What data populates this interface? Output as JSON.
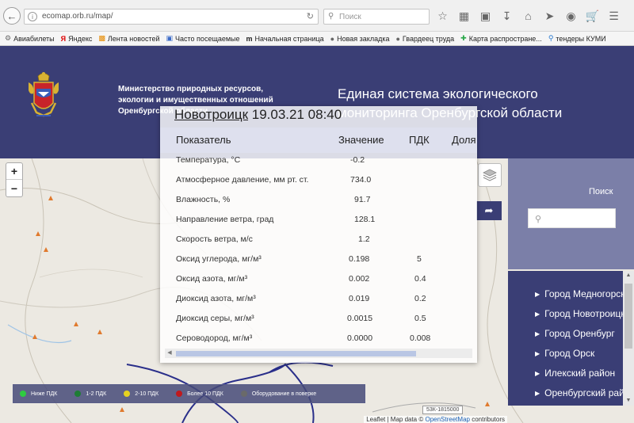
{
  "browser": {
    "url": "ecomap.orb.ru/map/",
    "search_placeholder": "Поиск",
    "toolbar_icons": [
      "star-icon",
      "clipboard-icon",
      "gift-icon",
      "download-icon",
      "home-icon",
      "send-icon",
      "eye-icon",
      "cart-icon",
      "menu-icon"
    ],
    "bookmarks": [
      {
        "label": "Авиабилеты",
        "icon": "gear-icon"
      },
      {
        "label": "Яндекс",
        "icon": "yandex-icon"
      },
      {
        "label": "Лента новостей",
        "icon": "feed-icon"
      },
      {
        "label": "Часто посещаемые",
        "icon": "star-icon"
      },
      {
        "label": "Начальная страница",
        "icon": "m-icon"
      },
      {
        "label": "Новая закладка",
        "icon": "globe-icon"
      },
      {
        "label": "Гвардеец труда",
        "icon": "globe-icon"
      },
      {
        "label": "Карта распростране...",
        "icon": "plus-icon"
      },
      {
        "label": "тендеры КУМИ",
        "icon": "pin-icon"
      }
    ]
  },
  "header": {
    "ministry_lines": [
      "Министерство природных ресурсов,",
      "экологии и имущественных отношений",
      "Оренбургской области"
    ],
    "title_lines": [
      "Единая система экологического",
      "мониторинга Оренбургской области"
    ]
  },
  "popup": {
    "city": "Новотроицк",
    "datetime": "19.03.21 08:40",
    "columns": [
      "Показатель",
      "Значение",
      "ПДК",
      "Доля ПДК"
    ],
    "rows": [
      {
        "name": "Температура, °С",
        "value": "-0.2",
        "pdk": ""
      },
      {
        "name": "Атмосферное давление, мм рт. ст.",
        "value": "734.0",
        "pdk": ""
      },
      {
        "name": "Влажность, %",
        "value": "91.7",
        "pdk": ""
      },
      {
        "name": "Направление ветра, град",
        "value": "128.1",
        "pdk": ""
      },
      {
        "name": "Скорость ветра, м/с",
        "value": "1.2",
        "pdk": ""
      },
      {
        "name": "Оксид углерода, мг/м³",
        "value": "0.198",
        "pdk": "5"
      },
      {
        "name": "Оксид азота, мг/м³",
        "value": "0.002",
        "pdk": "0.4"
      },
      {
        "name": "Диоксид азота, мг/м³",
        "value": "0.019",
        "pdk": "0.2"
      },
      {
        "name": "Диоксид серы, мг/м³",
        "value": "0.0015",
        "pdk": "0.5"
      },
      {
        "name": "Сероводород, мг/м³",
        "value": "0.0000",
        "pdk": "0.008"
      }
    ]
  },
  "map": {
    "zoom_in": "+",
    "zoom_out": "−",
    "legend": [
      {
        "label": "Ниже ПДК",
        "color": "#2ecc40"
      },
      {
        "label": "1-2 ПДК",
        "color": "#1e7d35"
      },
      {
        "label": "2-10 ПДК",
        "color": "#e6d21e"
      },
      {
        "label": "Более 10 ПДК",
        "color": "#c0191d"
      },
      {
        "label": "Оборудование в поверке",
        "color": "#6a6a6a"
      }
    ],
    "road_label": "53К-1815000",
    "attribution_prefix": "Leaflet | Map data ©",
    "attribution_link": "OpenStreetMap",
    "attribution_suffix": "contributors"
  },
  "sidebar": {
    "search_label": "Поиск",
    "items": [
      "Город Медногорск",
      "Город Новотроицк",
      "Город Оренбург",
      "Город Орск",
      "Илекский район",
      "Оренбургский район"
    ]
  },
  "colors": {
    "header_bg": "#3a3e75",
    "sidebar_search_bg": "#7b7fa8"
  }
}
